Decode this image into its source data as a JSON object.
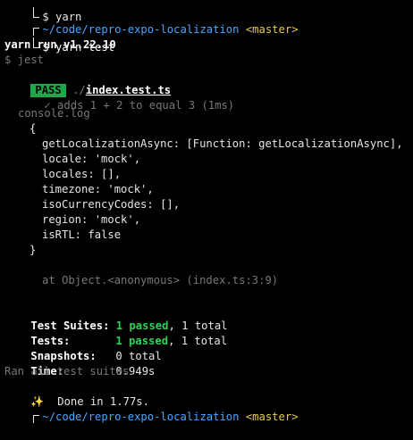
{
  "terminal": {
    "top_fragment": "$ yarn",
    "prompt_path": "~/code/repro-expo-localization",
    "prompt_branch": "<master>",
    "command": "$ yarn test",
    "yarn_version": "yarn run v1.22.10",
    "jest_cmd": "$ jest",
    "pass_label": "PASS",
    "test_dir": "./",
    "test_file": "index.test.ts",
    "test_result": "✓ adds 1 + 2 to equal 3 (1ms)",
    "console_title": "console.log",
    "obj_open": "{",
    "obj_lines": [
      "getLocalizationAsync: [Function: getLocalizationAsync],",
      "locale: 'mock',",
      "locales: [],",
      "timezone: 'mock',",
      "isoCurrencyCodes: [],",
      "region: 'mock',",
      "isRTL: false"
    ],
    "obj_close": "}",
    "stack_line": "at Object.<anonymous> (index.ts:3:9)",
    "summary": {
      "suites_label": "Test Suites:",
      "suites_passed": "1 passed",
      "suites_total": ", 1 total",
      "tests_label": "Tests:",
      "tests_passed": "1 passed",
      "tests_total": ", 1 total",
      "snapshots_label": "Snapshots:",
      "snapshots_value": "0 total",
      "time_label": "Time:",
      "time_value": "0.949s"
    },
    "ran_all": "Ran all test suites.",
    "done_icon": "✨",
    "done_text": "Done in 1.77s.",
    "bottom_prompt_path": "~/code/repro-expo-localization",
    "bottom_prompt_branch": "<master>"
  }
}
